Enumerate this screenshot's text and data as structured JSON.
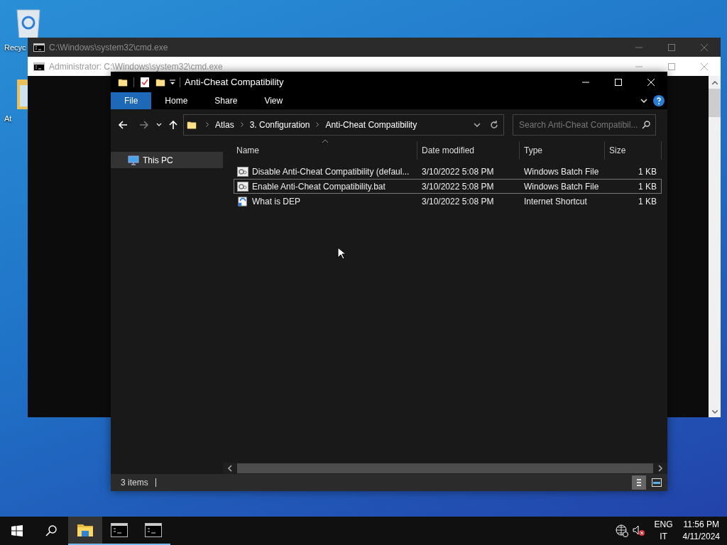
{
  "desktop_icons": [
    {
      "kind": "recycle",
      "label": "Recyc"
    },
    {
      "kind": "folder",
      "label": "At"
    }
  ],
  "back_window": {
    "title": "C:\\Windows\\system32\\cmd.exe"
  },
  "front_window": {
    "title": "Administrator: C:\\Windows\\system32\\cmd.exe"
  },
  "explorer": {
    "title": "Anti-Cheat Compatibility",
    "ribbon_tabs": [
      {
        "label": "File",
        "selected": true
      },
      {
        "label": "Home",
        "selected": false
      },
      {
        "label": "Share",
        "selected": false
      },
      {
        "label": "View",
        "selected": false
      }
    ],
    "breadcrumb": [
      "Atlas",
      "3. Configuration",
      "Anti-Cheat Compatibility"
    ],
    "search": {
      "placeholder": "Search Anti-Cheat Compatibil..."
    },
    "nav_items": [
      {
        "label": "This PC",
        "selected": true
      }
    ],
    "columns": [
      "Name",
      "Date modified",
      "Type",
      "Size"
    ],
    "files": [
      {
        "kind": "batch",
        "name": "Disable Anti-Cheat Compatibility (defaul...",
        "date": "3/10/2022 5:08 PM",
        "type": "Windows Batch File",
        "size": "1 KB",
        "selected": false
      },
      {
        "kind": "batch",
        "name": "Enable Anti-Cheat Compatibility.bat",
        "date": "3/10/2022 5:08 PM",
        "type": "Windows Batch File",
        "size": "1 KB",
        "selected": true
      },
      {
        "kind": "shortcut",
        "name": "What is DEP",
        "date": "3/10/2022 5:08 PM",
        "type": "Internet Shortcut",
        "size": "1 KB",
        "selected": false
      }
    ],
    "status": "3 items"
  },
  "taskbar": {
    "apps": [
      {
        "kind": "explorer",
        "selected": true
      },
      {
        "kind": "cmd",
        "selected": false
      },
      {
        "kind": "cmd",
        "selected": false
      }
    ],
    "language": "ENG",
    "layout": "IT",
    "time": "11:56 PM",
    "date": "4/11/2024"
  }
}
